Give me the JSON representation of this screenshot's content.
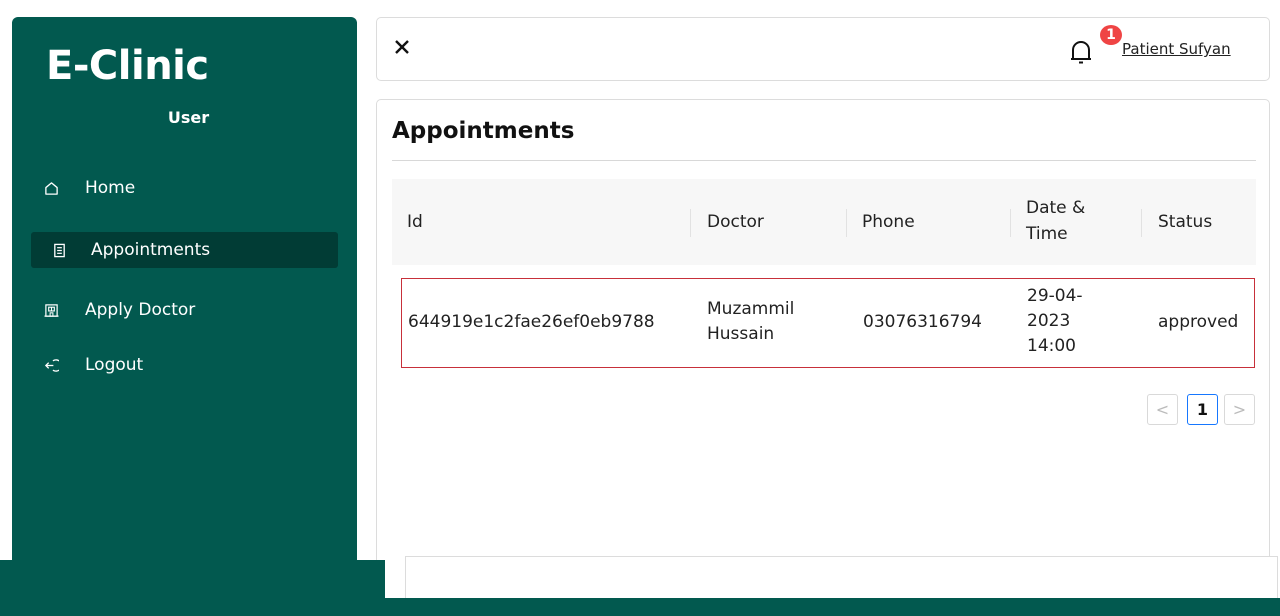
{
  "sidebar": {
    "brand": "E-Clinic",
    "role": "User",
    "items": [
      {
        "label": "Home",
        "icon": "home-icon"
      },
      {
        "label": "Appointments",
        "icon": "list-icon"
      },
      {
        "label": "Apply Doctor",
        "icon": "hospital-icon"
      },
      {
        "label": "Logout",
        "icon": "logout-icon"
      }
    ]
  },
  "header": {
    "close_glyph": "×",
    "notification_count": "1",
    "user_name": "Patient Sufyan"
  },
  "main": {
    "title": "Appointments",
    "columns": [
      "Id",
      "Doctor",
      "Phone",
      "Date & Time",
      "Status"
    ],
    "rows": [
      {
        "id": "644919e1c2fae26ef0eb9788",
        "doctor": "Muzammil Hussain",
        "phone": "03076316794",
        "datetime": "29-04-2023 14:00",
        "status": "approved"
      }
    ],
    "pagination": {
      "prev": "<",
      "current": "1",
      "next": ">"
    }
  },
  "colors": {
    "sidebar_bg": "#02594f",
    "active_item_bg": "#013c35",
    "badge": "#ef4444",
    "page_link": "#1677ff",
    "row_outline": "#c7303a"
  }
}
